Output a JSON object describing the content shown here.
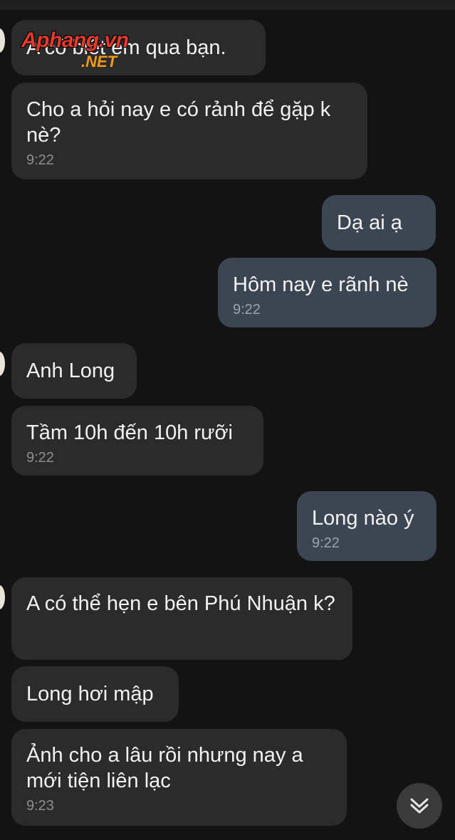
{
  "watermark": {
    "main": "Aphang.vn",
    "suffix": ".NET"
  },
  "messages": [
    {
      "text": "A có biết em qua bạn.",
      "time": ""
    },
    {
      "text": "Cho a hỏi nay e có rảnh để gặp k nè?",
      "time": "9:22"
    },
    {
      "text": "Dạ ai ạ",
      "time": ""
    },
    {
      "text": "Hôm nay e rãnh nè",
      "time": "9:22"
    },
    {
      "text": "Anh Long",
      "time": ""
    },
    {
      "text": "Tầm 10h đến 10h rưỡi",
      "time": "9:22"
    },
    {
      "text": "Long nào ý",
      "time": "9:22"
    },
    {
      "text": "A có thể hẹn e bên Phú Nhuận k?",
      "time": ""
    },
    {
      "text": "Long hơi mập",
      "time": ""
    },
    {
      "text": "Ảnh cho a lâu rồi nhưng nay a mới tiện liên lạc",
      "time": "9:23"
    }
  ],
  "scroll_button": {
    "icon": "double-chevron-down-icon"
  },
  "colors": {
    "background": "#131313",
    "incoming_bubble": "#2b2b2b",
    "outgoing_bubble": "#3c4552",
    "text": "#f2f2f2",
    "time": "#8e8e8e"
  }
}
